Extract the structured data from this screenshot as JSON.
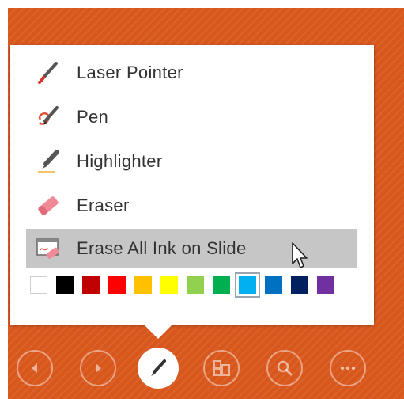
{
  "menu": {
    "items": [
      {
        "label": "Laser Pointer",
        "icon": "laser-pointer-icon"
      },
      {
        "label": "Pen",
        "icon": "pen-icon"
      },
      {
        "label": "Highlighter",
        "icon": "highlighter-icon"
      },
      {
        "label": "Eraser",
        "icon": "eraser-icon"
      },
      {
        "label": "Erase All Ink on Slide",
        "icon": "erase-all-ink-icon",
        "hovered": true
      }
    ],
    "colors": [
      "#ffffff",
      "#000000",
      "#c00000",
      "#ff0000",
      "#ffc000",
      "#ffff00",
      "#92d050",
      "#00b050",
      "#00b0f0",
      "#0070c0",
      "#002060",
      "#7030a0"
    ],
    "selected_color": "#00b0f0"
  },
  "toolbar": {
    "buttons": [
      {
        "icon": "previous-icon"
      },
      {
        "icon": "next-icon"
      },
      {
        "icon": "pen-tool-icon",
        "active": true
      },
      {
        "icon": "see-all-slides-icon"
      },
      {
        "icon": "zoom-icon"
      },
      {
        "icon": "more-options-icon"
      }
    ]
  },
  "theme": {
    "slide_background": "#d8571c",
    "highlight": "#c6c6c6",
    "pen_accent": "#e0533a"
  }
}
